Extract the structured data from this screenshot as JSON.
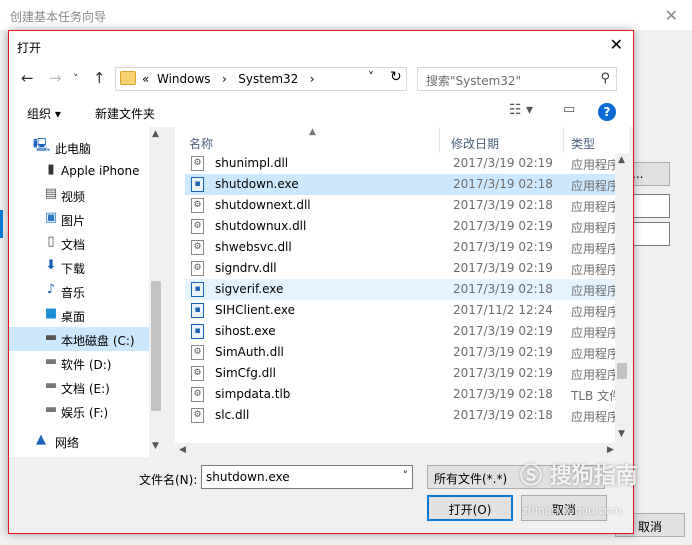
{
  "background_window": {
    "title": "创建基本任务向导",
    "browse_label": "R)...",
    "cancel_label": "取消"
  },
  "dialog": {
    "title": "打开",
    "address": {
      "path_prefix": "«",
      "segments": [
        "Windows",
        "System32"
      ]
    },
    "search_placeholder": "搜索\"System32\"",
    "toolbar": {
      "organize_label": "组织 ▾",
      "new_folder_label": "新建文件夹"
    },
    "nav_items": [
      {
        "label": "此电脑",
        "icon": "computer-icon"
      },
      {
        "label": "Apple iPhone",
        "icon": "phone-icon"
      },
      {
        "label": "视频",
        "icon": "video-icon"
      },
      {
        "label": "图片",
        "icon": "picture-icon"
      },
      {
        "label": "文档",
        "icon": "document-icon"
      },
      {
        "label": "下载",
        "icon": "download-icon"
      },
      {
        "label": "音乐",
        "icon": "music-icon"
      },
      {
        "label": "桌面",
        "icon": "desktop-icon"
      },
      {
        "label": "本地磁盘 (C:)",
        "icon": "drive-icon",
        "selected": true
      },
      {
        "label": "软件 (D:)",
        "icon": "drive-icon"
      },
      {
        "label": "文档 (E:)",
        "icon": "drive-icon"
      },
      {
        "label": "娱乐 (F:)",
        "icon": "drive-icon"
      },
      {
        "label": "网络",
        "icon": "network-icon"
      }
    ],
    "columns": {
      "name": "名称",
      "date": "修改日期",
      "type": "类型"
    },
    "files": [
      {
        "name": "shunimpl.dll",
        "date": "2017/3/19 02:19",
        "type": "应用程序",
        "kind": "dll"
      },
      {
        "name": "shutdown.exe",
        "date": "2017/3/19 02:18",
        "type": "应用程序",
        "kind": "exe",
        "selected": true
      },
      {
        "name": "shutdownext.dll",
        "date": "2017/3/19 02:18",
        "type": "应用程序",
        "kind": "dll"
      },
      {
        "name": "shutdownux.dll",
        "date": "2017/3/19 02:19",
        "type": "应用程序",
        "kind": "dll"
      },
      {
        "name": "shwebsvc.dll",
        "date": "2017/3/19 02:19",
        "type": "应用程序",
        "kind": "dll"
      },
      {
        "name": "signdrv.dll",
        "date": "2017/3/19 02:19",
        "type": "应用程序",
        "kind": "dll"
      },
      {
        "name": "sigverif.exe",
        "date": "2017/3/19 02:18",
        "type": "应用程序",
        "kind": "exe",
        "hover": true
      },
      {
        "name": "SIHClient.exe",
        "date": "2017/11/2 12:24",
        "type": "应用程序",
        "kind": "exe"
      },
      {
        "name": "sihost.exe",
        "date": "2017/3/19 02:19",
        "type": "应用程序",
        "kind": "exe"
      },
      {
        "name": "SimAuth.dll",
        "date": "2017/3/19 02:19",
        "type": "应用程序",
        "kind": "dll"
      },
      {
        "name": "SimCfg.dll",
        "date": "2017/3/19 02:19",
        "type": "应用程序",
        "kind": "dll"
      },
      {
        "name": "simpdata.tlb",
        "date": "2017/3/19 02:18",
        "type": "TLB 文件",
        "kind": "tlb"
      },
      {
        "name": "slc.dll",
        "date": "2017/3/19 02:18",
        "type": "应用程序",
        "kind": "dll"
      }
    ],
    "filename_label": "文件名(N):",
    "filename_value": "shutdown.exe",
    "filter_label": "所有文件(*.*)",
    "open_label": "打开(O)",
    "cancel_label": "取消"
  },
  "watermark": {
    "text": "搜狗指南",
    "sub": "zhinan.sogou.com"
  }
}
